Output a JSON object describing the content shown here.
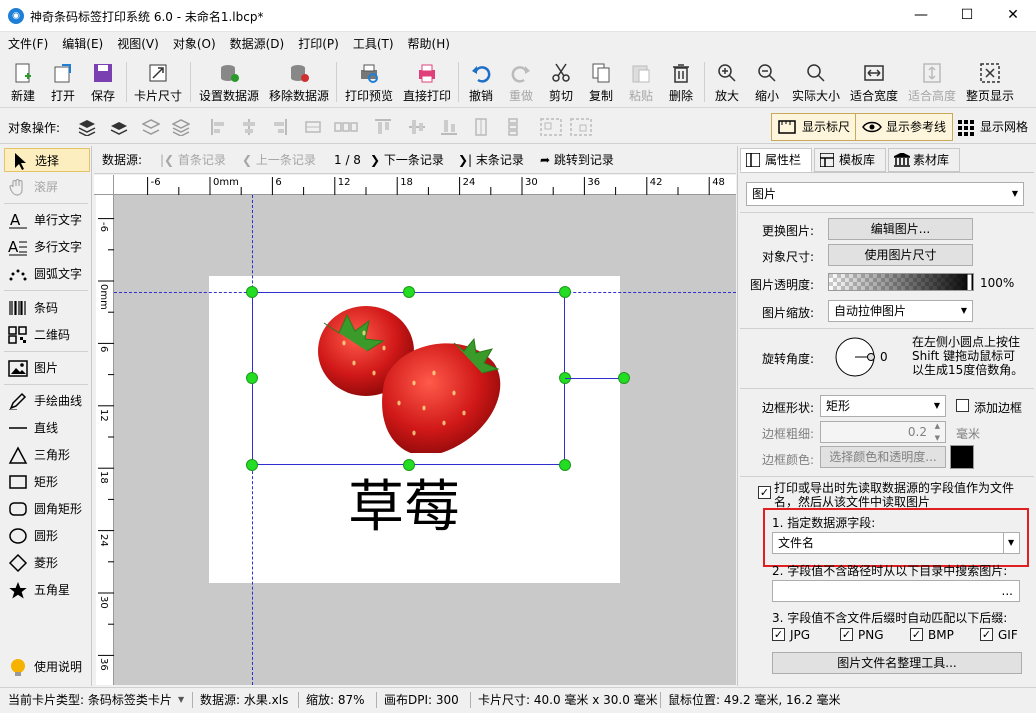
{
  "window": {
    "title": "神奇条码标签打印系统 6.0 - 未命名1.lbcp*",
    "minimize": "—",
    "maximize": "☐",
    "close": "✕"
  },
  "menu": [
    "文件(F)",
    "编辑(E)",
    "视图(V)",
    "对象(O)",
    "数据源(D)",
    "打印(P)",
    "工具(T)",
    "帮助(H)"
  ],
  "toolbar": {
    "new": "新建",
    "open": "打开",
    "save": "保存",
    "card_size": "卡片尺寸",
    "set_datasource": "设置数据源",
    "remove_datasource": "移除数据源",
    "print_preview": "打印预览",
    "direct_print": "直接打印",
    "undo": "撤销",
    "redo": "重做",
    "cut": "剪切",
    "copy": "复制",
    "paste": "粘贴",
    "delete": "删除",
    "zoom_in": "放大",
    "zoom_out": "缩小",
    "actual_size": "实际大小",
    "fit_width": "适合宽度",
    "fit_height": "适合高度",
    "full_page": "整页显示"
  },
  "objrow": {
    "label": "对象操作:",
    "show_ruler": "显示标尺",
    "show_guides": "显示参考线",
    "show_grid": "显示网格"
  },
  "tools": {
    "select": "选择",
    "scroll": "滚屏",
    "single_text": "单行文字",
    "multi_text": "多行文字",
    "arc_text": "圆弧文字",
    "barcode": "条码",
    "qrcode": "二维码",
    "image": "图片",
    "freehand": "手绘曲线",
    "line": "直线",
    "triangle": "三角形",
    "rect": "矩形",
    "round_rect": "圆角矩形",
    "circle": "圆形",
    "diamond": "菱形",
    "star": "五角星",
    "help": "使用说明"
  },
  "nav": {
    "label": "数据源:",
    "first": "首条记录",
    "prev": "上一条记录",
    "position": "1 / 8",
    "next": "下一条记录",
    "last": "末条记录",
    "jump": "跳转到记录"
  },
  "ruler": {
    "h": [
      "-6",
      "0mm",
      "6",
      "12",
      "18",
      "24",
      "30",
      "36",
      "42",
      "48"
    ],
    "v": [
      "-6",
      "0mm",
      "6",
      "12",
      "18",
      "24",
      "30",
      "36"
    ]
  },
  "label_text": "草莓",
  "panel": {
    "tabs": [
      "属性栏",
      "模板库",
      "素材库"
    ],
    "object_type": "图片",
    "change_image_label": "更换图片:",
    "edit_image_btn": "编辑图片...",
    "obj_size_label": "对象尺寸:",
    "use_image_size_btn": "使用图片尺寸",
    "opacity_label": "图片透明度:",
    "opacity_value": 1.0,
    "opacity_text": "100%",
    "scale_label": "图片缩放:",
    "scale_value": "自动拉伸图片",
    "rotate_label": "旋转角度:",
    "rotate_value": "0",
    "rotate_hint": [
      "在左侧小圆点上按住",
      "Shift 键拖动鼠标可",
      "以生成15度倍数角。"
    ],
    "border_shape_label": "边框形状:",
    "border_shape_value": "矩形",
    "add_border": "添加边框",
    "border_width_label": "边框粗细:",
    "border_width_value": "0.2",
    "border_width_unit": "毫米",
    "border_color_label": "边框颜色:",
    "border_color_btn": "选择颜色和透明度...",
    "border_color": "#000000",
    "read_from_field": [
      "打印或导出时先读取数据源的字段值作为文件",
      "名，然后从该文件中读取图片"
    ],
    "step1": "1. 指定数据源字段:",
    "field_value": "文件名",
    "step2": "2. 字段值不含路径时从以下目录中搜索图片:",
    "dir_value": "",
    "browse": "...",
    "step3": "3. 字段值不含文件后缀时自动匹配以下后缀:",
    "exts": [
      "JPG",
      "PNG",
      "BMP",
      "GIF"
    ],
    "organize_btn": "图片文件名整理工具..."
  },
  "status": {
    "card_type": "当前卡片类型:  条码标签类卡片",
    "datasource": "数据源:  水果.xls",
    "zoom": "缩放:  87%",
    "dpi": "画布DPI:  300",
    "card_size": "卡片尺寸:  40.0 毫米 x 30.0 毫米",
    "mouse": "鼠标位置:  49.2 毫米,  16.2 毫米"
  },
  "colors": {
    "accent": "#1e7fd8",
    "selection": "#fdeec0",
    "handle": "#22dd22",
    "highlight_box": "#e02020"
  }
}
